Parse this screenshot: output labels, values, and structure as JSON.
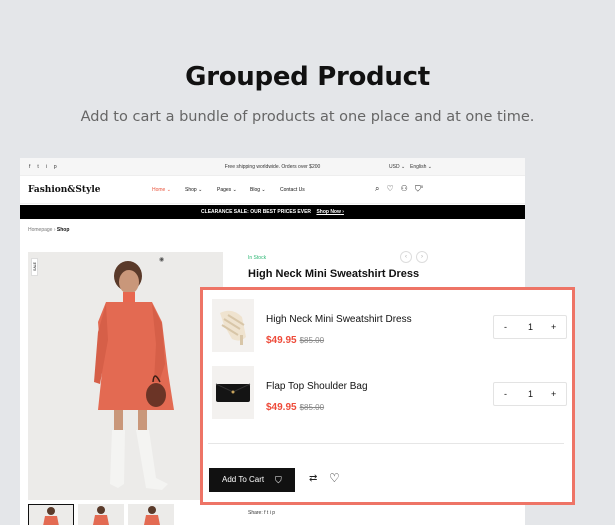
{
  "hero": {
    "title": "Grouped Product",
    "subtitle": "Add to cart a bundle of products at one place and at one time."
  },
  "topbar": {
    "social": [
      "f",
      "t",
      "i",
      "p"
    ],
    "shipping": "Free shipping worldwide. Orders over $200",
    "currency": "USD",
    "language": "English"
  },
  "nav": {
    "logo": "Fashion&Style",
    "menu": [
      "Home",
      "Shop",
      "Pages",
      "Blog",
      "Contact Us"
    ],
    "cart_count": "0"
  },
  "banner": {
    "text": "CLEARANCE SALE: OUR BEST PRICES EVER",
    "link": "Shop Now"
  },
  "breadcrumb": {
    "home": "Homepage",
    "current": "Shop"
  },
  "product": {
    "badge": "SALE",
    "stock": "In Stock",
    "title": "High Neck Mini Sweatshirt Dress",
    "share_label": "Share:"
  },
  "grouped": {
    "items": [
      {
        "name": "High Neck Mini Sweatshirt Dress",
        "price": "$49.95",
        "old_price": "$85.00",
        "qty": "1"
      },
      {
        "name": "Flap Top Shoulder Bag",
        "price": "$49.95",
        "old_price": "$85.00",
        "qty": "1"
      }
    ],
    "add_to_cart": "Add To Cart",
    "minus": "-",
    "plus": "+"
  },
  "colors": {
    "accent": "#ee7466",
    "price": "#ee4b3a",
    "stock": "#2bb673"
  }
}
